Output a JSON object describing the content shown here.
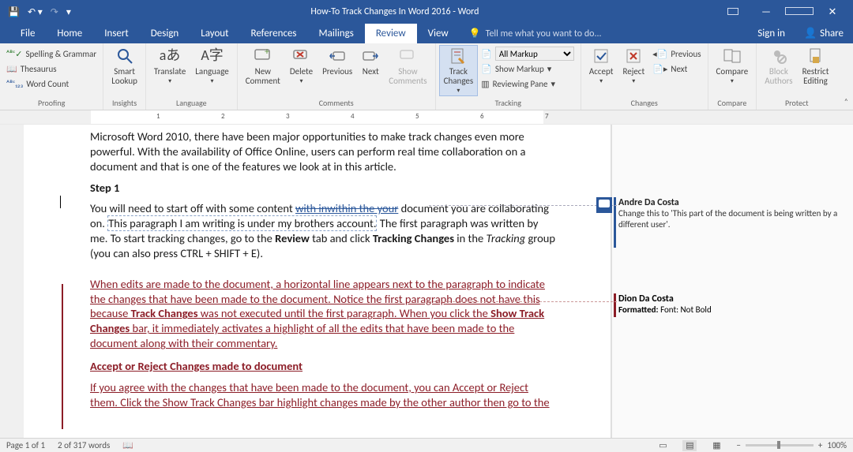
{
  "titlebar": {
    "title": "How-To Track Changes In Word 2016 - Word"
  },
  "tabs": [
    "File",
    "Home",
    "Insert",
    "Design",
    "Layout",
    "References",
    "Mailings",
    "Review",
    "View"
  ],
  "active_tab": "Review",
  "tellme_placeholder": "Tell me what you want to do...",
  "signin": "Sign in",
  "share": "Share",
  "ribbon": {
    "proofing": {
      "label": "Proofing",
      "spelling": "Spelling & Grammar",
      "thesaurus": "Thesaurus",
      "wordcount": "Word Count"
    },
    "insights": {
      "label": "Insights",
      "smart_lookup": "Smart\nLookup"
    },
    "language": {
      "label": "Language",
      "translate": "Translate",
      "language": "Language"
    },
    "comments": {
      "label": "Comments",
      "new": "New\nComment",
      "delete": "Delete",
      "previous": "Previous",
      "next": "Next",
      "show": "Show\nComments"
    },
    "tracking": {
      "label": "Tracking",
      "track": "Track\nChanges",
      "markup_options": [
        "All Markup"
      ],
      "show_markup": "Show Markup",
      "reviewing_pane": "Reviewing Pane"
    },
    "changes": {
      "label": "Changes",
      "accept": "Accept",
      "reject": "Reject",
      "prev": "Previous",
      "next": "Next"
    },
    "compare": {
      "label": "Compare",
      "compare": "Compare"
    },
    "protect": {
      "label": "Protect",
      "block": "Block\nAuthors",
      "restrict": "Restrict\nEditing"
    }
  },
  "doc": {
    "p1": "Microsoft Word 2010, there have been major opportunities to make track changes even more powerful. With the availability of Office Online, users can perform real time collaboration on a document and that is one of the features we look at in this article.",
    "step1": "Step 1",
    "p2a": "You will need to start off with some content ",
    "p2ins": "with inwithin the your",
    "p2b": " document you are collaborating on. ",
    "p2box": "This paragraph I am writing is under my brothers account.",
    "p2c": " The first paragraph was written by me. To start tracking changes, go to the ",
    "p2r": "Review",
    "p2d": " tab and click ",
    "p2t": "Tracking Changes",
    "p2e": " in the ",
    "p2i": "Tracking",
    "p2f": " group (you can also press CTRL + SHIFT + E).",
    "p3a": "When edits are made to the document, a horizontal line appears next to the paragraph to indicate the changes that have been made to the document. Notice the first paragraph does not have this because ",
    "p3b": "Track Changes",
    "p3c": " was not executed until the first paragraph. When you click the ",
    "p3d": "Show Track Changes",
    "p3e": " bar, it immediately activates a highlight of all the edits that have been made to the document along with their commentary.",
    "h2": "Accept or Reject Changes made to document",
    "p4": "If you agree with the changes that have been made to the document, you can Accept or Reject them. Click the Show Track Changes bar highlight changes made by the other author then go to the"
  },
  "comments_pane": {
    "c1_name": "Andre Da Costa",
    "c1_text": "Change this to 'This part of the document is being written by a different user'.",
    "c2_name": "Dion Da Costa",
    "c2_label": "Formatted:",
    "c2_text": " Font: Not Bold"
  },
  "status": {
    "page": "Page 1 of 1",
    "words": "2 of 317 words",
    "zoom": "100%"
  }
}
